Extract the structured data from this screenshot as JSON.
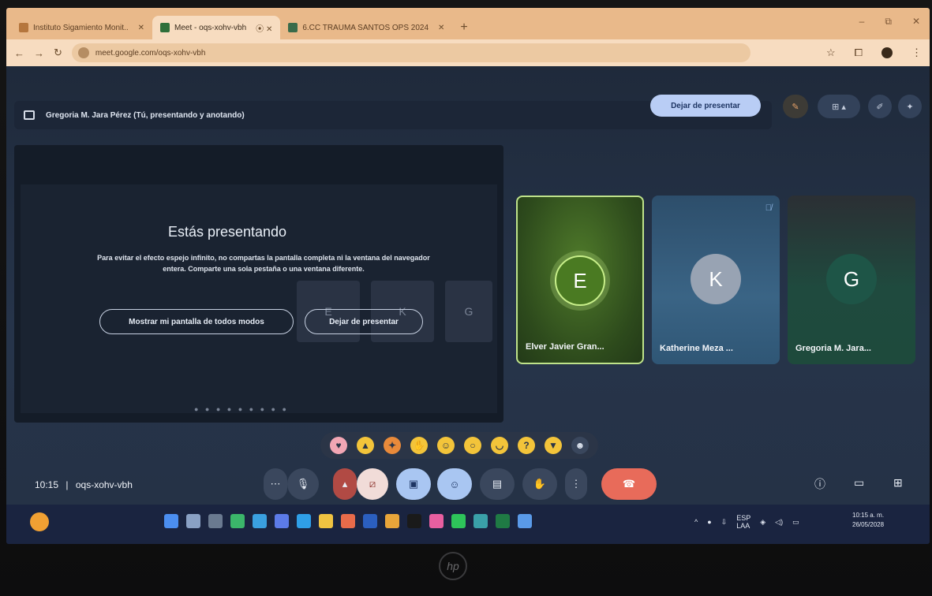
{
  "browser": {
    "tabs": [
      {
        "label": "Instituto Sigamiento Monit.."
      },
      {
        "label": "Meet - oqs-xohv-vbh"
      },
      {
        "label": "6.CC TRAUMA SANTOS OPS 2024"
      }
    ],
    "address": "meet.google.com/oqs-xohv-vbh",
    "colors": {
      "chrome": "#e9b98a",
      "active_tab": "#f7dcc0"
    }
  },
  "presenting_bar": {
    "text": "Gregoria M. Jara Pérez (Tú, presentando y anotando)",
    "stop_button": "Dejar de presentar"
  },
  "shared_preview": {
    "title": "Estás presentando",
    "message": "Para evitar el efecto espejo infinito, no compartas la pantalla completa ni la ventana del navegador entera. Comparte una sola pestaña o una ventana diferente.",
    "show_button": "Mostrar mi pantalla de todos modos",
    "stop_button": "Dejar de presentar",
    "mini_tiles": [
      "E",
      "K",
      "G"
    ]
  },
  "participants": [
    {
      "initial": "E",
      "name": "Elver Javier Gran...",
      "speaking": true,
      "color": "#4a7a22"
    },
    {
      "initial": "K",
      "name": "Katherine Meza ...",
      "muted": true,
      "color": "#98a3b3"
    },
    {
      "initial": "G",
      "name": "Gregoria M. Jara...",
      "color": "#1e5547"
    }
  ],
  "reactions": [
    "heart",
    "thumbs-up",
    "party-popper",
    "clap",
    "laugh",
    "surprised",
    "tearful",
    "thinking",
    "thumbs-down",
    "add-reaction"
  ],
  "meeting_info": {
    "time": "10:15",
    "separator": "|",
    "code": "oqs-xohv-vbh"
  },
  "controls": {
    "accent_leave": "#e86b5a",
    "accent_active": "#a9c6f2"
  },
  "taskbar": {
    "lang": "ESP",
    "lang_sub": "LAA",
    "time": "10:15 a. m.",
    "date": "26/05/2028"
  },
  "bezel_logo": "hp"
}
